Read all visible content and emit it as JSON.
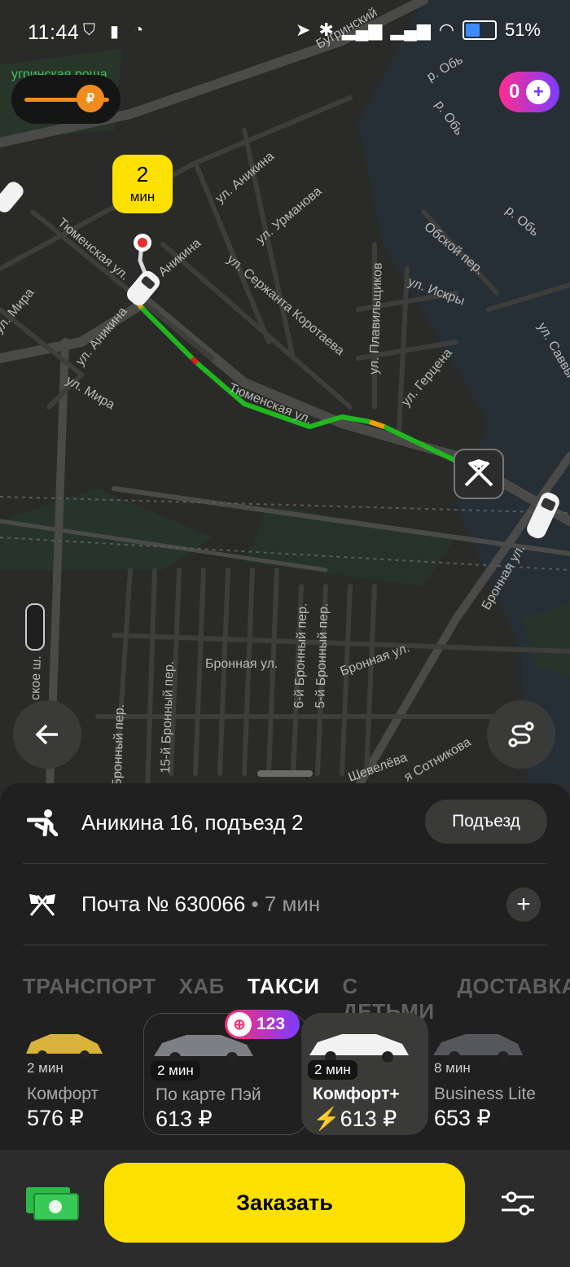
{
  "status_bar": {
    "time": "11:44",
    "battery": "51%",
    "battery_level": 0.51
  },
  "map": {
    "labels": {
      "tyumenskaya_1": "Тюменская ул.",
      "tyumenskaya_2": "Тюменская ул.",
      "anikina_1": "ул. Аникина",
      "anikina_2": "ул. Аникина",
      "anikina_3": "Аникина",
      "urmanova": "ул. Урманова",
      "serzhanta": "ул. Сержанта Коротаева",
      "plavilshchikov": "ул. Плавильщиков",
      "iskry": "ул. Искры",
      "gertsena": "ул. Герцена",
      "obskoy": "Обской пер.",
      "mira_1": "ул. Мира",
      "mira_2": "ул. Мира",
      "river_1": "р. Обь",
      "river_2": "р. Обь",
      "river_3": "р. Обь",
      "bronnaya_1": "Бронная ул.",
      "bronnaya_2": "Бронная ул.",
      "bronnaya_3": "Бронная ул.",
      "per_6": "6-й Бронный пер.",
      "per_5": "5-й Бронный пер.",
      "per_15": "15-й Бронный пер.",
      "per_x": "й Бронный пер.",
      "savvy": "ул. Саввы Кожевникова",
      "shevelyova": "Шевелёва",
      "sotnikova": "я Сотникова",
      "top_park": "угринская роща",
      "top_road": "Бугринский",
      "left_road": "ское ш."
    },
    "eta": {
      "value": "2",
      "unit": "мин"
    }
  },
  "fuel_pill": {
    "symbol": "₽"
  },
  "plus_pill": {
    "count": "0"
  },
  "pickup": {
    "address": "Аникина 16, подъезд 2",
    "entrance_button": "Подъезд"
  },
  "destination": {
    "name": "Почта № 630066",
    "time": " • 7 мин"
  },
  "tabs": [
    {
      "label": "ТРАНСПОРТ",
      "active": false
    },
    {
      "label": "ХАБ",
      "active": false
    },
    {
      "label": "ТАКСИ",
      "active": true
    },
    {
      "label": "С ДЕТЬМИ",
      "active": false
    },
    {
      "label": "ДОСТАВКА",
      "active": false
    }
  ],
  "promo_badge": {
    "count": "123"
  },
  "tariffs": [
    {
      "eta": "2 мин",
      "name": "Комфорт",
      "price": "576 ₽"
    },
    {
      "eta": "2 мин",
      "name": "По карте Пэй",
      "price": "613 ₽"
    },
    {
      "eta": "2 мин",
      "name": "Комфорт+",
      "price": "613 ₽"
    },
    {
      "eta": "8 мин",
      "name": "Business Lite",
      "price": "653 ₽"
    }
  ],
  "order_button": "Заказать",
  "colors": {
    "accent": "#fce000",
    "route_green": "#1fb81f",
    "route_orange": "#f0a000",
    "route_red": "#e02020",
    "plus_pink": "#ff2d8e",
    "plus_purple": "#7c3cff"
  }
}
